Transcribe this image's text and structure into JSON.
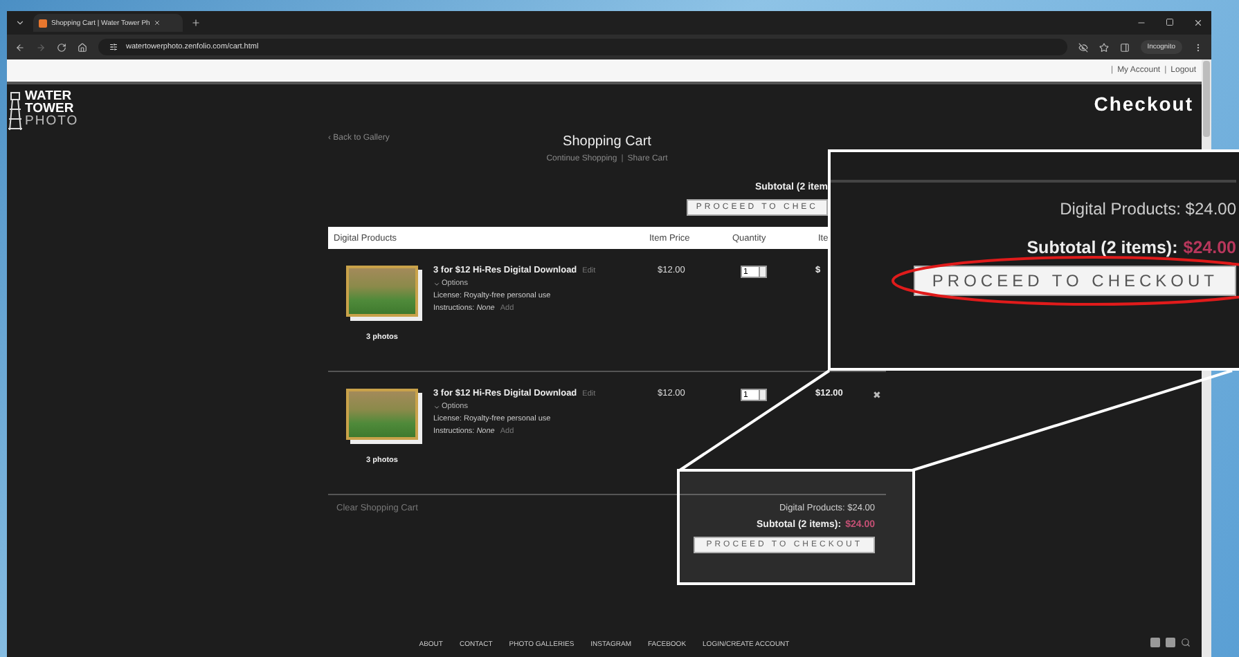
{
  "browser": {
    "tab_title": "Shopping Cart | Water Tower Ph",
    "url": "watertowerphoto.zenfolio.com/cart.html",
    "incognito_label": "Incognito"
  },
  "account_links": [
    {
      "separator": "|",
      "label": "My Account"
    },
    {
      "separator": "|",
      "label": "Logout"
    }
  ],
  "logo": {
    "lines": [
      "WATER",
      "TOWER",
      "PHOTO"
    ]
  },
  "page_title": "Checkout",
  "back_link": "‹ Back to Gallery",
  "cart": {
    "title": "Shopping Cart",
    "links": [
      "Continue Shopping",
      "Share Cart"
    ],
    "link_separator": "|",
    "top_subtotal": "Subtotal (2 item",
    "top_checkout": "PROCEED TO CHEC",
    "columns": [
      "Digital Products",
      "Item Price",
      "Quantity",
      "Ite"
    ],
    "items": [
      {
        "title": "3 for $12 Hi-Res Digital Download",
        "edit": "Edit",
        "options": "Options",
        "license": "License: Royalty-free personal use",
        "instructions": "Instructions: *None*",
        "add": "Add",
        "photos": "3 photos",
        "price": "$12.00",
        "quantity": "1",
        "total": "$"
      },
      {
        "title": "3 for $12 Hi-Res Digital Download",
        "edit": "Edit",
        "options": "Options",
        "license": "License: Royalty-free personal use",
        "instructions": "Instructions: *None*",
        "add": "Add",
        "photos": "3 photos",
        "price": "$12.00",
        "quantity": "1",
        "total": "$12.00",
        "remove": "✖"
      }
    ],
    "clear": "Clear Shopping Cart",
    "digital_products": "Digital Products: $24.00",
    "subtotal_label": "Subtotal (2 items):",
    "subtotal_value": "$24.00",
    "checkout": "PROCEED TO CHECKOUT"
  },
  "callout": {
    "digital_products": "Digital Products: $24.00",
    "subtotal_label": "Subtotal (2 items):",
    "subtotal_value": "$24.00",
    "checkout": "PROCEED TO CHECKOUT"
  },
  "footer": {
    "links": [
      "ABOUT",
      "CONTACT",
      "PHOTO GALLERIES",
      "INSTAGRAM",
      "FACEBOOK",
      "LOGIN/CREATE ACCOUNT"
    ]
  }
}
